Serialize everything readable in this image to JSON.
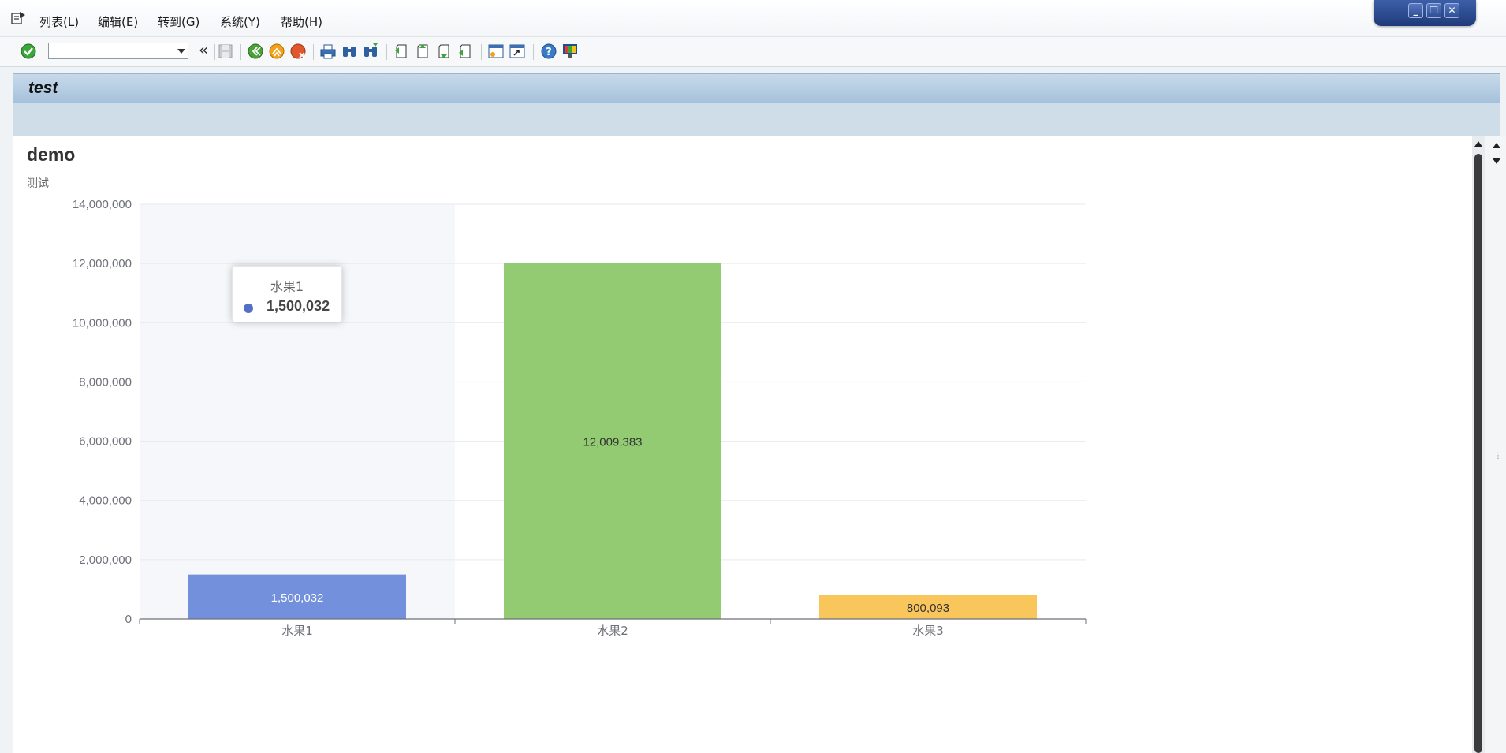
{
  "menu": {
    "items": [
      "列表(L)",
      "编辑(E)",
      "转到(G)",
      "系统(Y)",
      "帮助(H)"
    ]
  },
  "window": {
    "minimize": "_",
    "restore": "❐",
    "close": "✕"
  },
  "toolbar": {
    "command_field_value": "",
    "icons": [
      "enter-icon",
      "command-field",
      "back-double-icon",
      "save-icon",
      "back-icon",
      "exit-icon",
      "cancel-icon",
      "print-icon",
      "find-icon",
      "find-next-icon",
      "first-page-icon",
      "previous-page-icon",
      "next-page-icon",
      "last-page-icon",
      "create-session-icon",
      "shortcut-icon",
      "help-icon",
      "customize-layout-icon"
    ]
  },
  "screen": {
    "title": "test"
  },
  "chart_header": {
    "title": "demo",
    "subtitle": "测试"
  },
  "tooltip": {
    "name": "水果1",
    "value": "1,500,032"
  },
  "colors": {
    "series": [
      "#7390dc",
      "#93cb72",
      "#f9c65b"
    ],
    "tooltip_dot": "#5470c6",
    "highlight_band": "#f5f7fb"
  },
  "chart_data": {
    "type": "bar",
    "title": "demo",
    "subtitle": "测试",
    "categories": [
      "水果1",
      "水果2",
      "水果3"
    ],
    "values": [
      1500032,
      12009383,
      800093
    ],
    "value_labels": [
      "1,500,032",
      "12,009,383",
      "800,093"
    ],
    "y_ticks": [
      "0",
      "2,000,000",
      "4,000,000",
      "6,000,000",
      "8,000,000",
      "10,000,000",
      "12,000,000",
      "14,000,000"
    ],
    "ylim": [
      0,
      14000000
    ],
    "grid": true,
    "highlighted_category": "水果1"
  }
}
